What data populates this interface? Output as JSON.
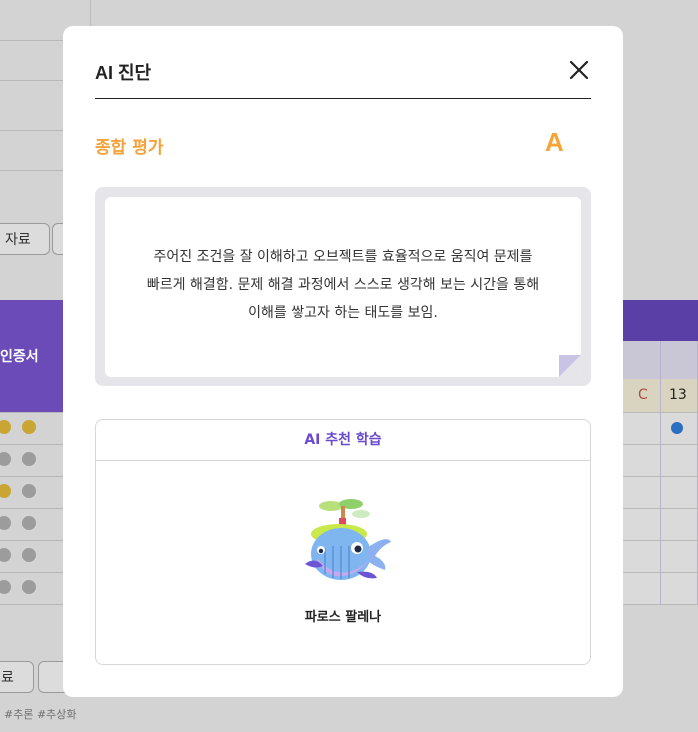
{
  "background": {
    "button_resource_1": "자료",
    "button_resource_2": "료",
    "certificate_header": "인증서",
    "grade_cell": "C",
    "number_cell": "13",
    "tags": "#추론 #추상화"
  },
  "modal": {
    "title": "AI 진단",
    "section_label": "종합 평가",
    "grade": "A",
    "comment_lines": [
      "주어진 조건을 잘 이해하고 오브젝트를 효율적으로 움직여 문제를",
      "빠르게 해결함. 문제 해결 과정에서 스스로 생각해 보는 시간을 통해",
      "이해를 쌓고자 하는 태도를 보임."
    ],
    "recommend": {
      "title": "AI 추천 학습",
      "items": [
        {
          "name": "파로스 팔레나",
          "icon": "whale-island-icon"
        }
      ]
    }
  },
  "colors": {
    "accent_orange": "#f4a23a",
    "accent_purple": "#6a4bd0"
  }
}
